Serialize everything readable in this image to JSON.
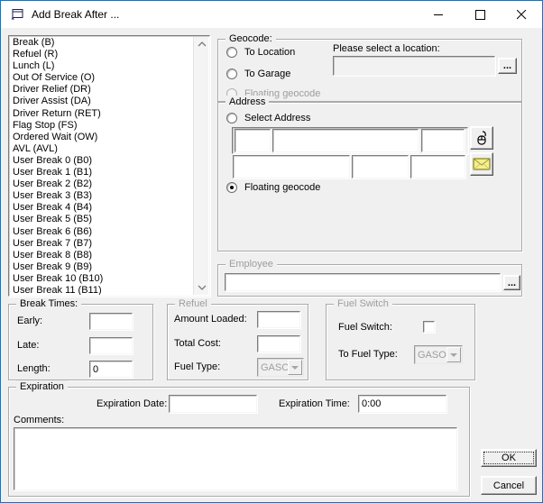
{
  "window": {
    "title": "Add Break After ...",
    "icon": "form-icon",
    "controls": {
      "minimize": "minimize",
      "maximize": "maximize",
      "close": "close"
    }
  },
  "colors": {
    "accent_border": "#0079d8",
    "titlebar_bg": "#ffffff",
    "dialog_bg": "#f0f0f0",
    "disabled_text": "#9d9d9d",
    "envelope_yellow": "#f5ef8e"
  },
  "break_list": {
    "items": [
      "Break (B)",
      "Refuel (R)",
      "Lunch (L)",
      "Out Of Service (O)",
      "Driver Relief (DR)",
      "Driver Assist (DA)",
      "Driver Return (RET)",
      "Flag Stop (FS)",
      "Ordered Wait (OW)",
      "AVL (AVL)",
      "User Break 0 (B0)",
      "User Break 1 (B1)",
      "User Break 2 (B2)",
      "User Break 3 (B3)",
      "User Break 4 (B4)",
      "User Break 5 (B5)",
      "User Break 6 (B6)",
      "User Break 7 (B7)",
      "User Break 8 (B8)",
      "User Break 9 (B9)",
      "User Break 10 (B10)",
      "User Break 11 (B11)"
    ]
  },
  "geocode": {
    "label": "Geocode:",
    "to_location_label": "To Location",
    "to_garage_label": "To Garage",
    "location_prompt": "Please select a location:",
    "location_value": "",
    "browse_label": "...",
    "floating_label": "Floating geocode"
  },
  "address": {
    "label": "Address",
    "select_address_label": "Select Address",
    "floating_label": "Floating geocode",
    "field1": "",
    "field2": "",
    "field3": "",
    "field4": "",
    "field5": "",
    "field6": "",
    "mouse_button_icon": "mouse-pick-icon",
    "envelope_button_icon": "envelope-icon"
  },
  "employee": {
    "label": "Employee",
    "value": "",
    "browse_label": "..."
  },
  "break_times": {
    "label": "Break Times:",
    "early_label": "Early:",
    "early_value": "",
    "late_label": "Late:",
    "late_value": "",
    "length_label": "Length:",
    "length_value": "0"
  },
  "refuel": {
    "label": "Refuel",
    "amount_label": "Amount Loaded:",
    "amount_value": "",
    "cost_label": "Total Cost:",
    "cost_value": "",
    "fuel_type_label": "Fuel Type:",
    "fuel_type_value": "GASOL"
  },
  "fuel_switch": {
    "label": "Fuel Switch",
    "switch_label": "Fuel Switch:",
    "switch_checked": false,
    "to_fuel_label": "To Fuel Type:",
    "to_fuel_value": "GASOL"
  },
  "expiration": {
    "label": "Expiration",
    "date_label": "Expiration Date:",
    "date_value": "",
    "time_label": "Expiration Time:",
    "time_value": "0:00",
    "comments_label": "Comments:",
    "comments_value": ""
  },
  "actions": {
    "ok": "OK",
    "cancel": "Cancel"
  }
}
